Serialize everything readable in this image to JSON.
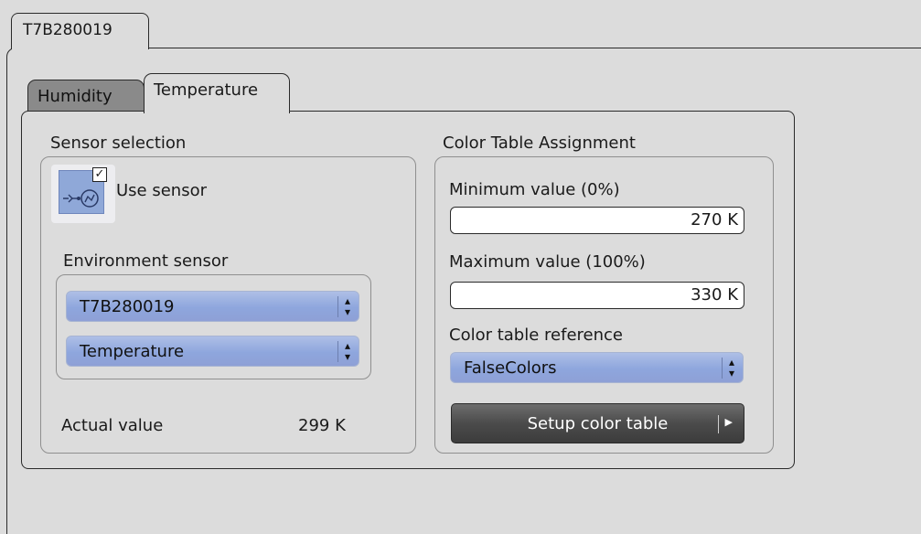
{
  "outer_tab": {
    "label": "T7B280019"
  },
  "tabs": [
    {
      "label": "Humidity",
      "active": false
    },
    {
      "label": "Temperature",
      "active": true
    }
  ],
  "sensor_selection": {
    "title": "Sensor selection",
    "use_sensor": {
      "label": "Use sensor",
      "checked": true,
      "icon": "sensor-icon"
    },
    "environment_sensor": {
      "title": "Environment sensor",
      "device": "T7B280019",
      "measurement": "Temperature"
    },
    "actual_value": {
      "label": "Actual value",
      "value": "299 K"
    }
  },
  "color_table_assignment": {
    "title": "Color Table Assignment",
    "minimum": {
      "label": "Minimum value (0%)",
      "value": "270 K"
    },
    "maximum": {
      "label": "Maximum value (100%)",
      "value": "330 K"
    },
    "reference": {
      "label": "Color table reference",
      "value": "FalseColors"
    },
    "setup_button": {
      "label": "Setup color table"
    }
  },
  "colors": {
    "background": "#dcdcdc",
    "combo_blue": "#8ea6dd",
    "inactive_tab": "#8a8a8a",
    "dark_button": "#4b4b4b"
  }
}
